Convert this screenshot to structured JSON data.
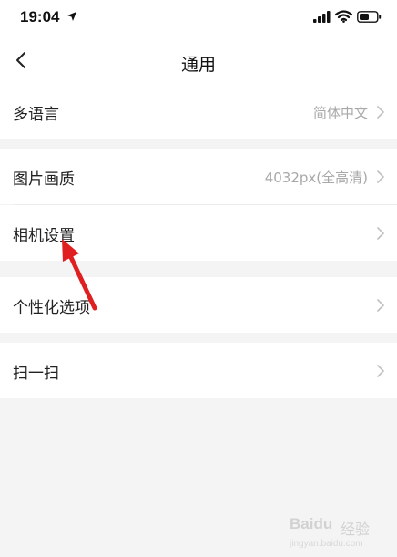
{
  "status_bar": {
    "time": "19:04"
  },
  "header": {
    "title": "通用"
  },
  "settings": {
    "language": {
      "label": "多语言",
      "value": "简体中文"
    },
    "image_quality": {
      "label": "图片画质",
      "value": "4032px(全高清)"
    },
    "camera": {
      "label": "相机设置"
    },
    "personalization": {
      "label": "个性化选项"
    },
    "scan": {
      "label": "扫一扫"
    }
  },
  "annotation": {
    "color": "#e02020"
  },
  "watermark": {
    "brand": "Baidu",
    "text": "经验",
    "url": "jingyan.baidu.com"
  },
  "colors": {
    "background": "#f4f4f4",
    "row": "#ffffff",
    "secondary_text": "#a8a8a8",
    "chevron": "#c0c0c0"
  }
}
